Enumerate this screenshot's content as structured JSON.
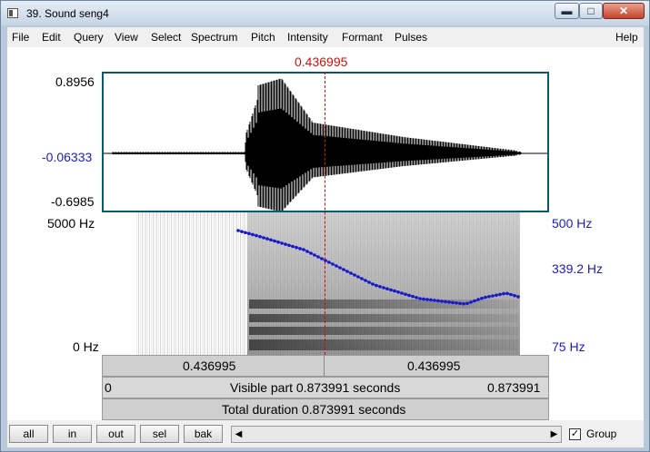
{
  "window": {
    "title": "39. Sound seng4",
    "controls": {
      "minimize": "▬",
      "maximize": "□",
      "close": "✕"
    }
  },
  "menu": [
    "File",
    "Edit",
    "Query",
    "View",
    "Select",
    "Spectrum",
    "Pitch",
    "Intensity",
    "Formant",
    "Pulses",
    "Help"
  ],
  "cursor": {
    "time_label": "0.436995"
  },
  "waveform": {
    "top_label": "0.8956",
    "mid_label": "-0.06333",
    "bottom_label": "-0.6985"
  },
  "spectrogram": {
    "top_left_label": "5000 Hz",
    "bottom_left_label": "0 Hz",
    "pitch_top_label": "500 Hz",
    "pitch_mid_label": "339.2 Hz",
    "pitch_bottom_label": "75 Hz"
  },
  "strips": {
    "left_segment": "0.436995",
    "right_segment": "0.436995",
    "visible_start": "0",
    "visible_part": "Visible part 0.873991 seconds",
    "visible_end": "0.873991",
    "total_duration": "Total duration 0.873991 seconds"
  },
  "buttons": {
    "all": "all",
    "in": "in",
    "out": "out",
    "sel": "sel",
    "bak": "bak"
  },
  "scrollbar": {
    "left_arrow": "◀",
    "right_arrow": "▶"
  },
  "group": {
    "label": "Group",
    "checked": true,
    "check_glyph": "✓"
  },
  "colors": {
    "cursor": "#d31010",
    "pitch_curve": "#1a1acc",
    "frame": "#0b5a6a"
  }
}
